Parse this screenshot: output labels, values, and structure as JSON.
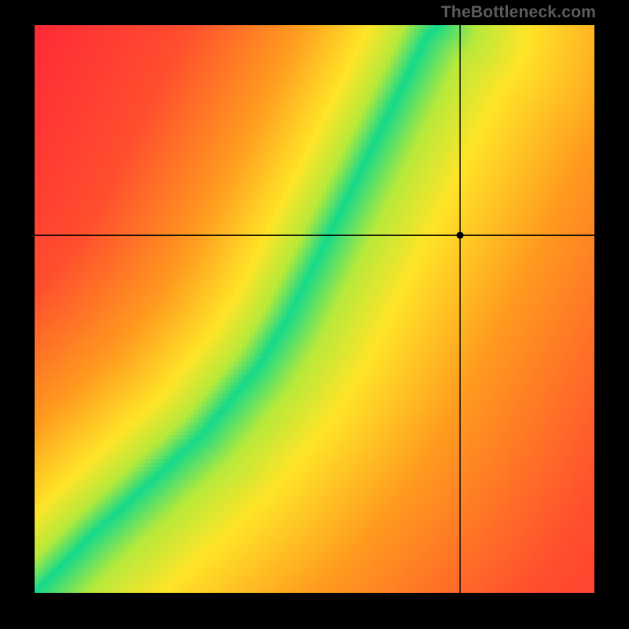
{
  "watermark": "TheBottleneck.com",
  "chart_data": {
    "type": "heatmap",
    "title": "",
    "xlabel": "",
    "ylabel": "",
    "xlim": [
      0,
      100
    ],
    "ylim": [
      0,
      100
    ],
    "grid": false,
    "legend": "none",
    "crosshair": {
      "x": 76,
      "y": 63
    },
    "marker": {
      "x": 76,
      "y": 63,
      "label": ""
    },
    "optimal_curve": {
      "description": "green ridge (valley of zero bottleneck)",
      "points_xy": [
        [
          0,
          0
        ],
        [
          10,
          10
        ],
        [
          20,
          19
        ],
        [
          30,
          28
        ],
        [
          40,
          40
        ],
        [
          45,
          48
        ],
        [
          50,
          58
        ],
        [
          55,
          68
        ],
        [
          60,
          78
        ],
        [
          65,
          88
        ],
        [
          70,
          98
        ],
        [
          72,
          100
        ]
      ]
    },
    "color_scale": {
      "description": "distance from optimal curve → color",
      "stops": [
        {
          "distance": 0,
          "color": "#14d98b"
        },
        {
          "distance": 6,
          "color": "#b7e93a"
        },
        {
          "distance": 14,
          "color": "#ffe428"
        },
        {
          "distance": 30,
          "color": "#ff9a1f"
        },
        {
          "distance": 55,
          "color": "#ff4e2e"
        },
        {
          "distance": 100,
          "color": "#ff1f3a"
        }
      ]
    },
    "note": "Axes are unlabeled in the source image; percent scale inferred from crosshair position and typical bottleneck-chart layout."
  }
}
